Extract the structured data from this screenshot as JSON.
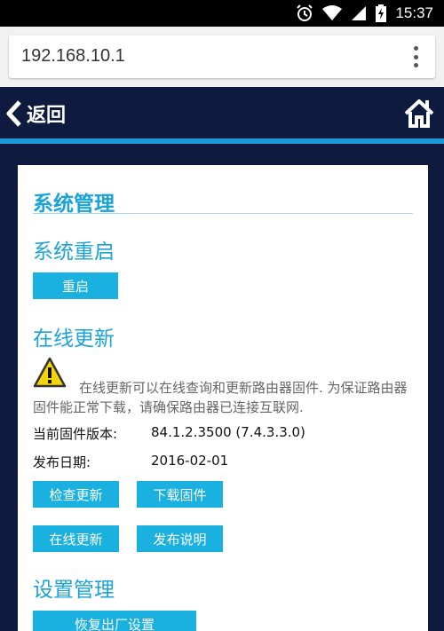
{
  "status_bar": {
    "time": "15:37",
    "icons": [
      "alarm-icon",
      "wifi-icon",
      "signal-icon",
      "battery-charging-icon"
    ]
  },
  "browser": {
    "url": "192.168.10.1",
    "menu_icon": "overflow-menu-icon"
  },
  "header": {
    "back_label": "返回",
    "back_icon": "chevron-left-icon",
    "home_icon": "home-icon"
  },
  "colors": {
    "header_bg": "#0f1a3f",
    "accent": "#1aa3d9",
    "button": "#1ab0e0"
  },
  "content": {
    "title": "系统管理",
    "reboot": {
      "title": "系统重启",
      "button": "重启"
    },
    "online_update": {
      "title": "在线更新",
      "warning_icon": "warning-icon",
      "notice": "在线更新可以在线查询和更新路由器固件. 为保证路由器固件能正常下载，请确保路由器已连接互联网.",
      "firmware_label": "当前固件版本:",
      "firmware_value": "84.1.2.3500 (7.4.3.3.0)",
      "release_label": "发布日期:",
      "release_value": "2016-02-01",
      "buttons": {
        "check": "检查更新",
        "download": "下载固件",
        "online": "在线更新",
        "release_notes": "发布说明"
      }
    },
    "settings": {
      "title": "设置管理",
      "factory_reset": "恢复出厂设置"
    }
  }
}
